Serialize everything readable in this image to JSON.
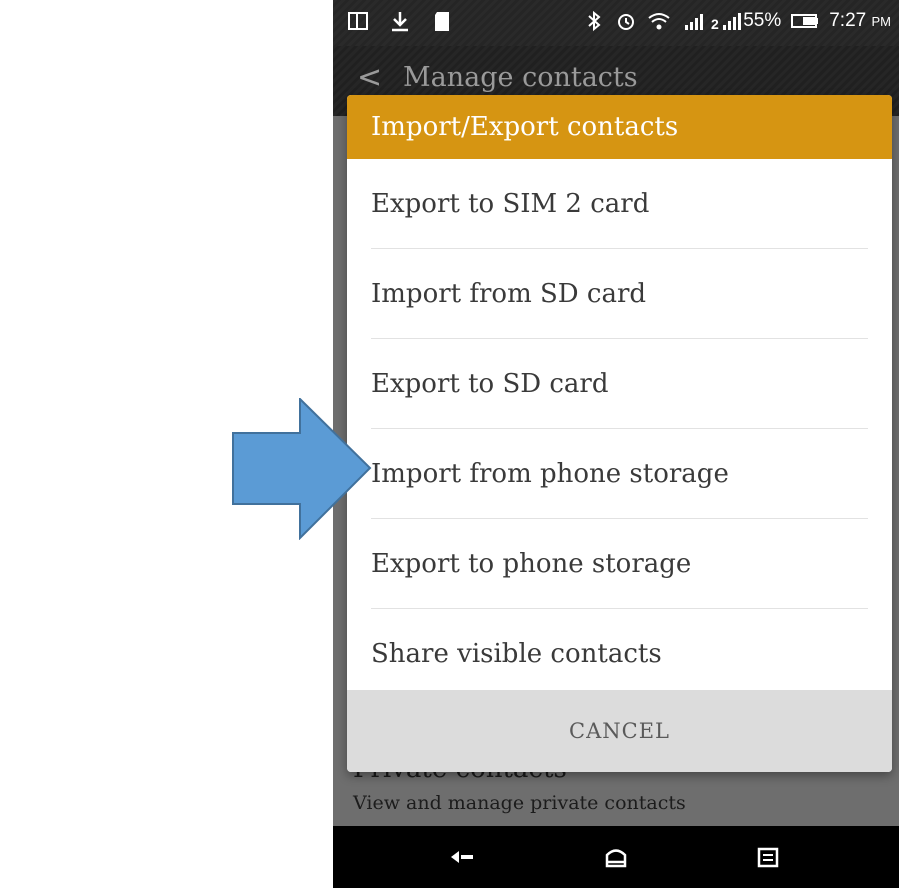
{
  "status_bar": {
    "battery_percent": "55%",
    "time": "7:27",
    "ampm": "PM",
    "left_icons": [
      "screen-mirror-icon",
      "download-icon",
      "sd-card-icon"
    ],
    "right_icons": [
      "bluetooth-icon",
      "alarm-icon",
      "wifi-icon",
      "signal-sim1-icon",
      "signal-sim2-icon",
      "battery-icon"
    ]
  },
  "top_bar": {
    "back_glyph": "<",
    "title": "Manage contacts"
  },
  "dialog": {
    "title": "Import/Export contacts",
    "items": [
      {
        "label": "Export to SIM 2 card"
      },
      {
        "label": "Import from SD card"
      },
      {
        "label": "Export to SD card"
      },
      {
        "label": "Import from phone storage"
      },
      {
        "label": "Export to phone storage"
      },
      {
        "label": "Share visible contacts"
      }
    ],
    "cancel_label": "CANCEL",
    "header_color": "#d69512"
  },
  "background_list": {
    "item_title": "Private contacts",
    "item_subtitle": "View and manage private contacts"
  },
  "nav_bar": {
    "buttons": [
      "back-icon",
      "home-icon",
      "recent-apps-icon"
    ]
  },
  "annotation": {
    "arrow_color": "#5b9bd5",
    "arrow_outline": "#41719c"
  }
}
